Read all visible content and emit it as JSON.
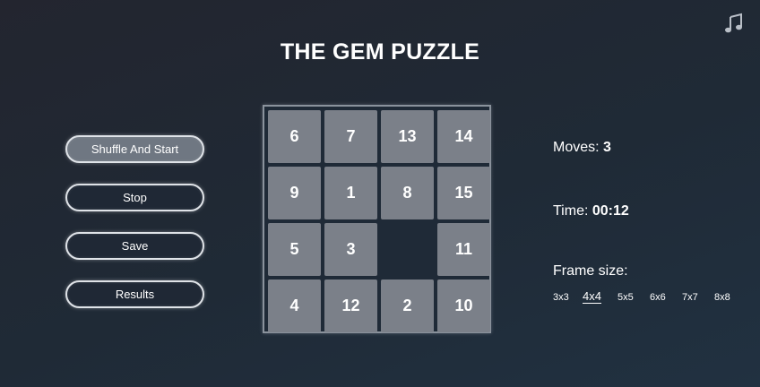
{
  "title": "THE GEM PUZZLE",
  "music_icon": "music-note-icon",
  "controls": [
    {
      "name": "shuffle-and-start-button",
      "label": "Shuffle And Start",
      "active": true
    },
    {
      "name": "stop-button",
      "label": "Stop",
      "active": false
    },
    {
      "name": "save-button",
      "label": "Save",
      "active": false
    },
    {
      "name": "results-button",
      "label": "Results",
      "active": false
    }
  ],
  "board": {
    "size": 4,
    "tiles": [
      [
        "6",
        "7",
        "13",
        "14"
      ],
      [
        "9",
        "1",
        "8",
        "15"
      ],
      [
        "5",
        "3",
        "",
        "11"
      ],
      [
        "4",
        "12",
        "2",
        "10"
      ]
    ]
  },
  "stats": {
    "moves_label": "Moves: ",
    "moves_value": "3",
    "time_label": "Time: ",
    "time_value": "00:12",
    "frame_label": "Frame size:"
  },
  "frame_sizes": [
    {
      "label": "3x3",
      "selected": false
    },
    {
      "label": "4x4",
      "selected": true
    },
    {
      "label": "5x5",
      "selected": false
    },
    {
      "label": "6x6",
      "selected": false
    },
    {
      "label": "7x7",
      "selected": false
    },
    {
      "label": "8x8",
      "selected": false
    }
  ],
  "colors": {
    "tile": "#7b8089",
    "board_bg": "#1f2a37",
    "active_button": "#6f7782"
  }
}
